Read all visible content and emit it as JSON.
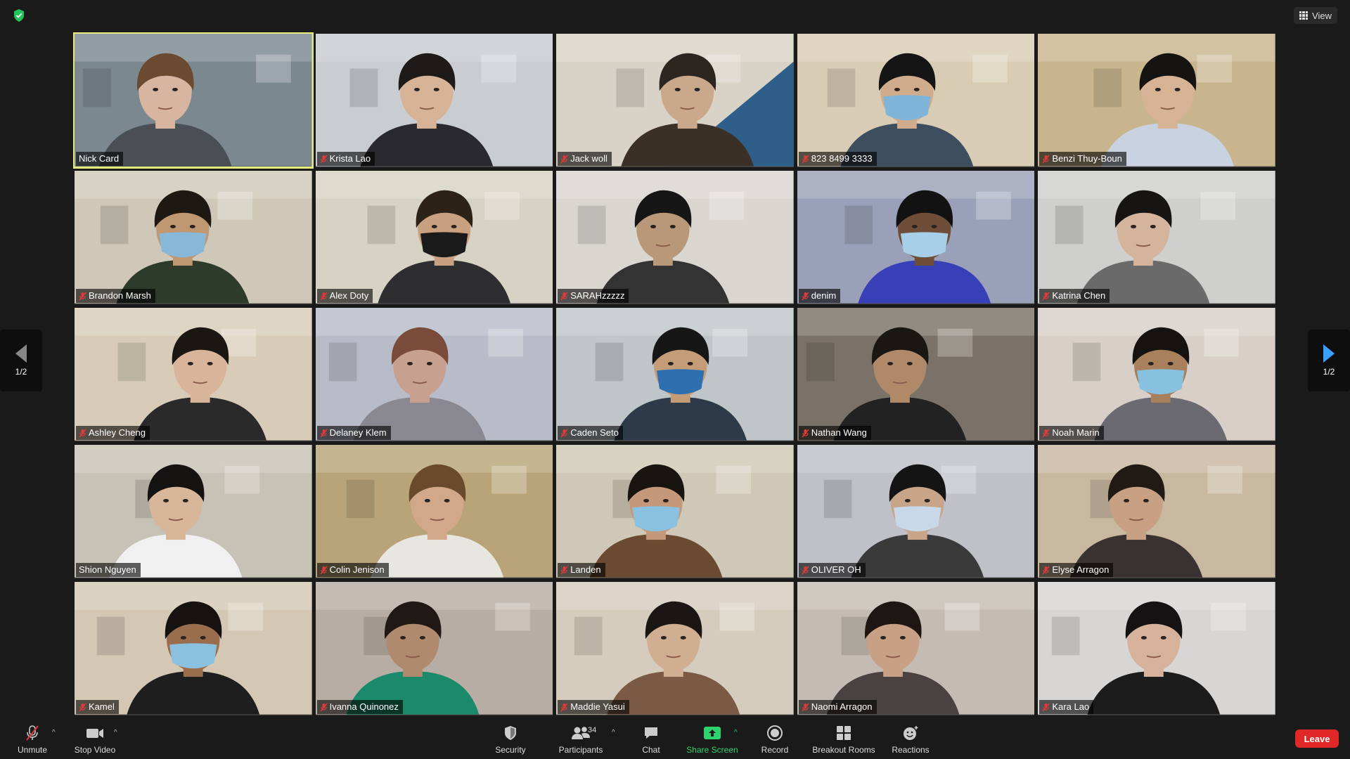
{
  "top_bar": {
    "view_label": "View"
  },
  "pagination": {
    "left_label": "1/2",
    "right_label": "1/2"
  },
  "participants": [
    {
      "name": "Nick Card",
      "muted": false,
      "active": true,
      "wall": "#7c8890",
      "skin": "#d8b5a0",
      "hair": "#6a4a30",
      "shirt": "#4a4f55",
      "mask": null
    },
    {
      "name": "Krista Lao",
      "muted": true,
      "active": false,
      "wall": "#c9ccd0",
      "skin": "#d6b296",
      "hair": "#1e1a18",
      "shirt": "#2a2a2e",
      "mask": null
    },
    {
      "name": "Jack woll",
      "muted": true,
      "active": false,
      "wall": "#d9d2c6",
      "skin": "#c9a88c",
      "hair": "#2d2620",
      "shirt": "#3a3026",
      "mask": null,
      "accent": "#2e5f8a"
    },
    {
      "name": "823 8499 3333",
      "muted": true,
      "active": false,
      "wall": "#d8ccb4",
      "skin": "#d1ac8c",
      "hair": "#151515",
      "shirt": "#3d4e5e",
      "mask": "#7fb5d8"
    },
    {
      "name": "Benzi Thuy-Boun",
      "muted": true,
      "active": false,
      "wall": "#c8b58e",
      "skin": "#d5b394",
      "hair": "#161412",
      "shirt": "#c8d2e0",
      "mask": null
    },
    {
      "name": "Brandon Marsh",
      "muted": true,
      "active": false,
      "wall": "#cfc8b8",
      "skin": "#bf9770",
      "hair": "#1d1812",
      "shirt": "#2e3a2a",
      "mask": "#88b8d8"
    },
    {
      "name": "Alex Doty",
      "muted": true,
      "active": false,
      "wall": "#d6d2c4",
      "skin": "#c9a080",
      "hair": "#2c2218",
      "shirt": "#2e2e30",
      "mask": "#1a1a1a"
    },
    {
      "name": "SARAHzzzzz",
      "muted": true,
      "active": false,
      "wall": "#d9d6d0",
      "skin": "#b89878",
      "hair": "#161616",
      "shirt": "#333",
      "mask": null
    },
    {
      "name": "denim",
      "muted": true,
      "active": false,
      "wall": "#9aa0b8",
      "skin": "#6e4e38",
      "hair": "#121212",
      "shirt": "#3840b8",
      "mask": "#a8cfe8"
    },
    {
      "name": "Katrina Chen",
      "muted": true,
      "active": false,
      "wall": "#cfcfcd",
      "skin": "#d4b49a",
      "hair": "#171514",
      "shirt": "#6a6a6a",
      "mask": null
    },
    {
      "name": "Ashley Cheng",
      "muted": true,
      "active": false,
      "wall": "#d8ccb8",
      "skin": "#d8b49a",
      "hair": "#1a1612",
      "shirt": "#2a2a2a",
      "mask": null
    },
    {
      "name": "Delaney Klem",
      "muted": true,
      "active": false,
      "wall": "#b8bcc8",
      "skin": "#c8a090",
      "hair": "#7a4a3a",
      "shirt": "#8a8890",
      "mask": null
    },
    {
      "name": "Caden Seto",
      "muted": true,
      "active": false,
      "wall": "#c0c6c8",
      "skin": "#c49c78",
      "hair": "#161616",
      "shirt": "#2c3a4a",
      "mask": "#2e6fb0"
    },
    {
      "name": "Nathan Wang",
      "muted": true,
      "active": false,
      "wall": "#7a7268",
      "skin": "#b08a68",
      "hair": "#1a1612",
      "shirt": "#222",
      "mask": null
    },
    {
      "name": "Noah Marin",
      "muted": true,
      "active": false,
      "wall": "#d8d0c8",
      "skin": "#a8805c",
      "hair": "#161210",
      "shirt": "#6a6a70",
      "mask": "#88c0e0"
    },
    {
      "name": "Shion Nguyen",
      "muted": false,
      "active": false,
      "wall": "#c6c2b6",
      "skin": "#d8b69a",
      "hair": "#151312",
      "shirt": "#f0f0f0",
      "mask": null
    },
    {
      "name": "Colin Jenison",
      "muted": true,
      "active": false,
      "wall": "#b8a478",
      "skin": "#d2a88a",
      "hair": "#6a4a2c",
      "shirt": "#e8e6e0",
      "mask": null
    },
    {
      "name": "Landen",
      "muted": true,
      "active": false,
      "wall": "#d0c8b6",
      "skin": "#c49878",
      "hair": "#181410",
      "shirt": "#6a4a30",
      "mask": "#8ac0e0"
    },
    {
      "name": "OLIVER OH",
      "muted": true,
      "active": false,
      "wall": "#bfc0c8",
      "skin": "#c8a488",
      "hair": "#141414",
      "shirt": "#3a3a3a",
      "mask": "#c8d8e8"
    },
    {
      "name": "Elyse Arragon",
      "muted": true,
      "active": false,
      "wall": "#c8b8a0",
      "skin": "#c8a084",
      "hair": "#221a14",
      "shirt": "#3a3230",
      "mask": null
    },
    {
      "name": "Kamel",
      "muted": true,
      "active": false,
      "wall": "#d4c8b4",
      "skin": "#9a6e4c",
      "hair": "#161210",
      "shirt": "#1e1e1e",
      "mask": "#8ac0e0"
    },
    {
      "name": "Ivanna Quinonez",
      "muted": true,
      "active": false,
      "wall": "#b8ada4",
      "skin": "#b08a6e",
      "hair": "#201814",
      "shirt": "#1a8a6a",
      "mask": null
    },
    {
      "name": "Maddie Yasui",
      "muted": true,
      "active": false,
      "wall": "#d6ccbe",
      "skin": "#d0ae92",
      "hair": "#1a1614",
      "shirt": "#7a5a44",
      "mask": null
    },
    {
      "name": "Naomi Arragon",
      "muted": true,
      "active": false,
      "wall": "#c4bcb4",
      "skin": "#c8a086",
      "hair": "#1e1612",
      "shirt": "#4a4240",
      "mask": null
    },
    {
      "name": "Kara Lao",
      "muted": true,
      "active": false,
      "wall": "#d8d6d4",
      "skin": "#d6b29a",
      "hair": "#141212",
      "shirt": "#1c1c1c",
      "mask": null
    }
  ],
  "toolbar": {
    "unmute_label": "Unmute",
    "stop_video_label": "Stop Video",
    "security_label": "Security",
    "participants_label": "Participants",
    "participants_count": "34",
    "chat_label": "Chat",
    "share_screen_label": "Share Screen",
    "record_label": "Record",
    "breakout_rooms_label": "Breakout Rooms",
    "reactions_label": "Reactions",
    "leave_label": "Leave"
  },
  "colors": {
    "background": "#1a1a1a",
    "active_speaker_border": "#e6ec7a",
    "share_green": "#2dd36f",
    "leave_red": "#e02828",
    "muted_red": "#e03a3a",
    "nav_arrow_blue": "#3aa0ff"
  }
}
